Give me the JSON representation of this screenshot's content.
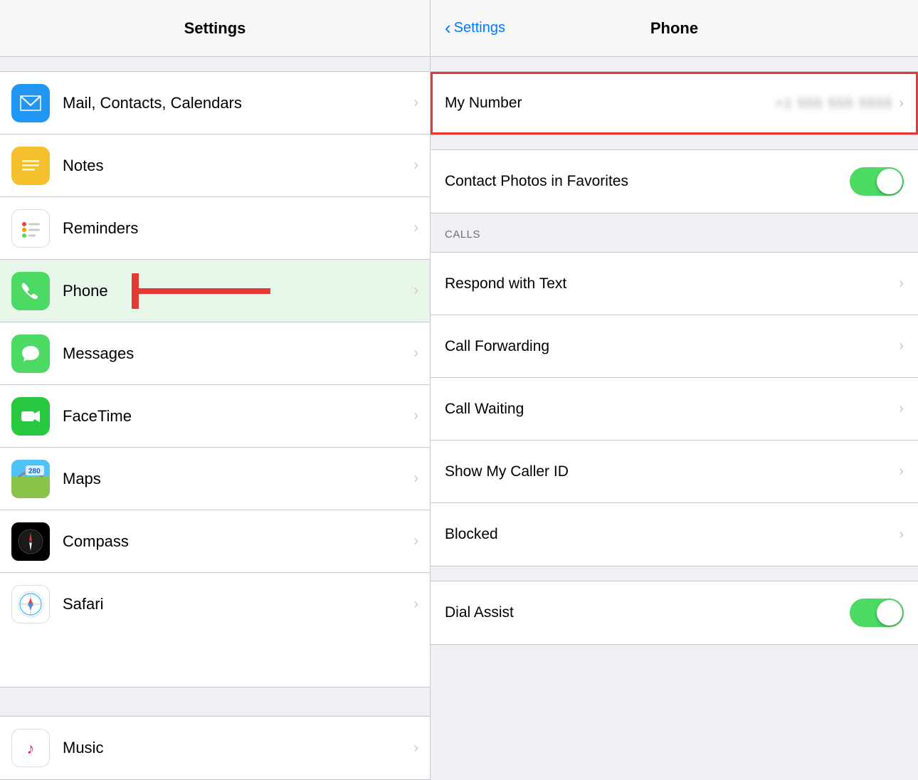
{
  "left": {
    "title": "Settings",
    "items": [
      {
        "id": "mail",
        "label": "Mail, Contacts, Calendars",
        "iconBg": "#2196f3",
        "iconText": "✉",
        "iconColor": "white"
      },
      {
        "id": "notes",
        "label": "Notes",
        "iconBg": "#f5c02d",
        "iconText": "📝",
        "iconColor": "white"
      },
      {
        "id": "reminders",
        "label": "Reminders",
        "iconBg": "#fff",
        "iconText": "🔴",
        "iconColor": ""
      },
      {
        "id": "phone",
        "label": "Phone",
        "iconBg": "#4cd964",
        "iconText": "📞",
        "iconColor": "white",
        "hasArrow": true
      },
      {
        "id": "messages",
        "label": "Messages",
        "iconBg": "#4cd964",
        "iconText": "💬",
        "iconColor": "white"
      },
      {
        "id": "facetime",
        "label": "FaceTime",
        "iconBg": "#28c940",
        "iconText": "🎥",
        "iconColor": "white"
      },
      {
        "id": "maps",
        "label": "Maps",
        "iconBg": "",
        "iconText": "🗺",
        "iconColor": "white"
      },
      {
        "id": "compass",
        "label": "Compass",
        "iconBg": "#000",
        "iconText": "🧭",
        "iconColor": "white"
      },
      {
        "id": "safari",
        "label": "Safari",
        "iconBg": "#fff",
        "iconText": "🧭",
        "iconColor": "blue"
      },
      {
        "id": "music",
        "label": "Music",
        "iconBg": "#fff",
        "iconText": "🎵",
        "iconColor": "pink"
      }
    ]
  },
  "right": {
    "backLabel": "Settings",
    "title": "Phone",
    "myNumberLabel": "My Number",
    "myNumberValue": "+• ••• ••• ••••",
    "contactPhotosLabel": "Contact Photos in Favorites",
    "callsSectionLabel": "CALLS",
    "items": [
      {
        "id": "respond-text",
        "label": "Respond with Text"
      },
      {
        "id": "call-forwarding",
        "label": "Call Forwarding"
      },
      {
        "id": "call-waiting",
        "label": "Call Waiting"
      },
      {
        "id": "caller-id",
        "label": "Show My Caller ID"
      },
      {
        "id": "blocked",
        "label": "Blocked"
      }
    ],
    "dialAssistLabel": "Dial Assist"
  }
}
